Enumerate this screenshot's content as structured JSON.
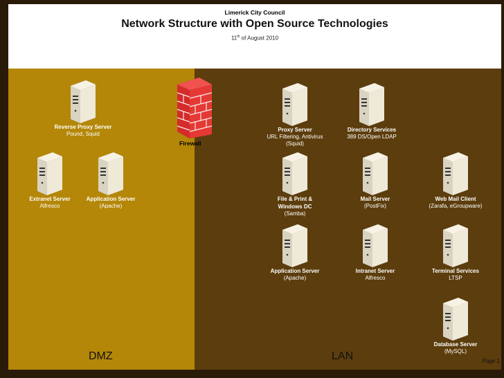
{
  "header": {
    "organization": "Limerick City Council",
    "title": "Network Structure with Open Source Technologies",
    "date_day": "11",
    "date_suffix": "th",
    "date_rest": " of August 2010"
  },
  "zones": {
    "dmz": "DMZ",
    "lan": "LAN"
  },
  "firewall": {
    "label": "Firewall",
    "color": "#d42b2b"
  },
  "page_label": "Page 1",
  "colors": {
    "dmz": "#b48708",
    "lan": "#5c3d0d",
    "header": "#ffffff"
  },
  "nodes": {
    "reverse_proxy": {
      "name": "Reverse Proxy Server",
      "desc": [
        "Pound, Squid"
      ]
    },
    "extranet": {
      "name": "Extranet Server",
      "desc": [
        "Alfresco"
      ]
    },
    "app_dmz": {
      "name": "Application Server",
      "desc": [
        "(Apache)"
      ]
    },
    "proxy": {
      "name": "Proxy Server",
      "desc": [
        "URL Filtering, Antivirus",
        "(Squid)"
      ]
    },
    "directory": {
      "name": "Directory Services",
      "desc": [
        "389 DS/Open LDAP"
      ]
    },
    "file_print": {
      "name": "File & Print &",
      "name2": "Windows DC",
      "desc": [
        "(Samba)"
      ]
    },
    "mail": {
      "name": "Mail Server",
      "desc": [
        "(PostFix)"
      ]
    },
    "webmail": {
      "name": "Web Mail Client",
      "desc": [
        "(Zarafa, eGroupware)"
      ]
    },
    "app_lan": {
      "name": "Application Server",
      "desc": [
        "(Apache)"
      ]
    },
    "intranet": {
      "name": "Intranet Server",
      "desc": [
        "Alfresco"
      ]
    },
    "terminal": {
      "name": "Terminal Services",
      "desc": [
        "LTSP"
      ]
    },
    "database": {
      "name": "Database Server",
      "desc": [
        "(MySQL)"
      ]
    }
  }
}
